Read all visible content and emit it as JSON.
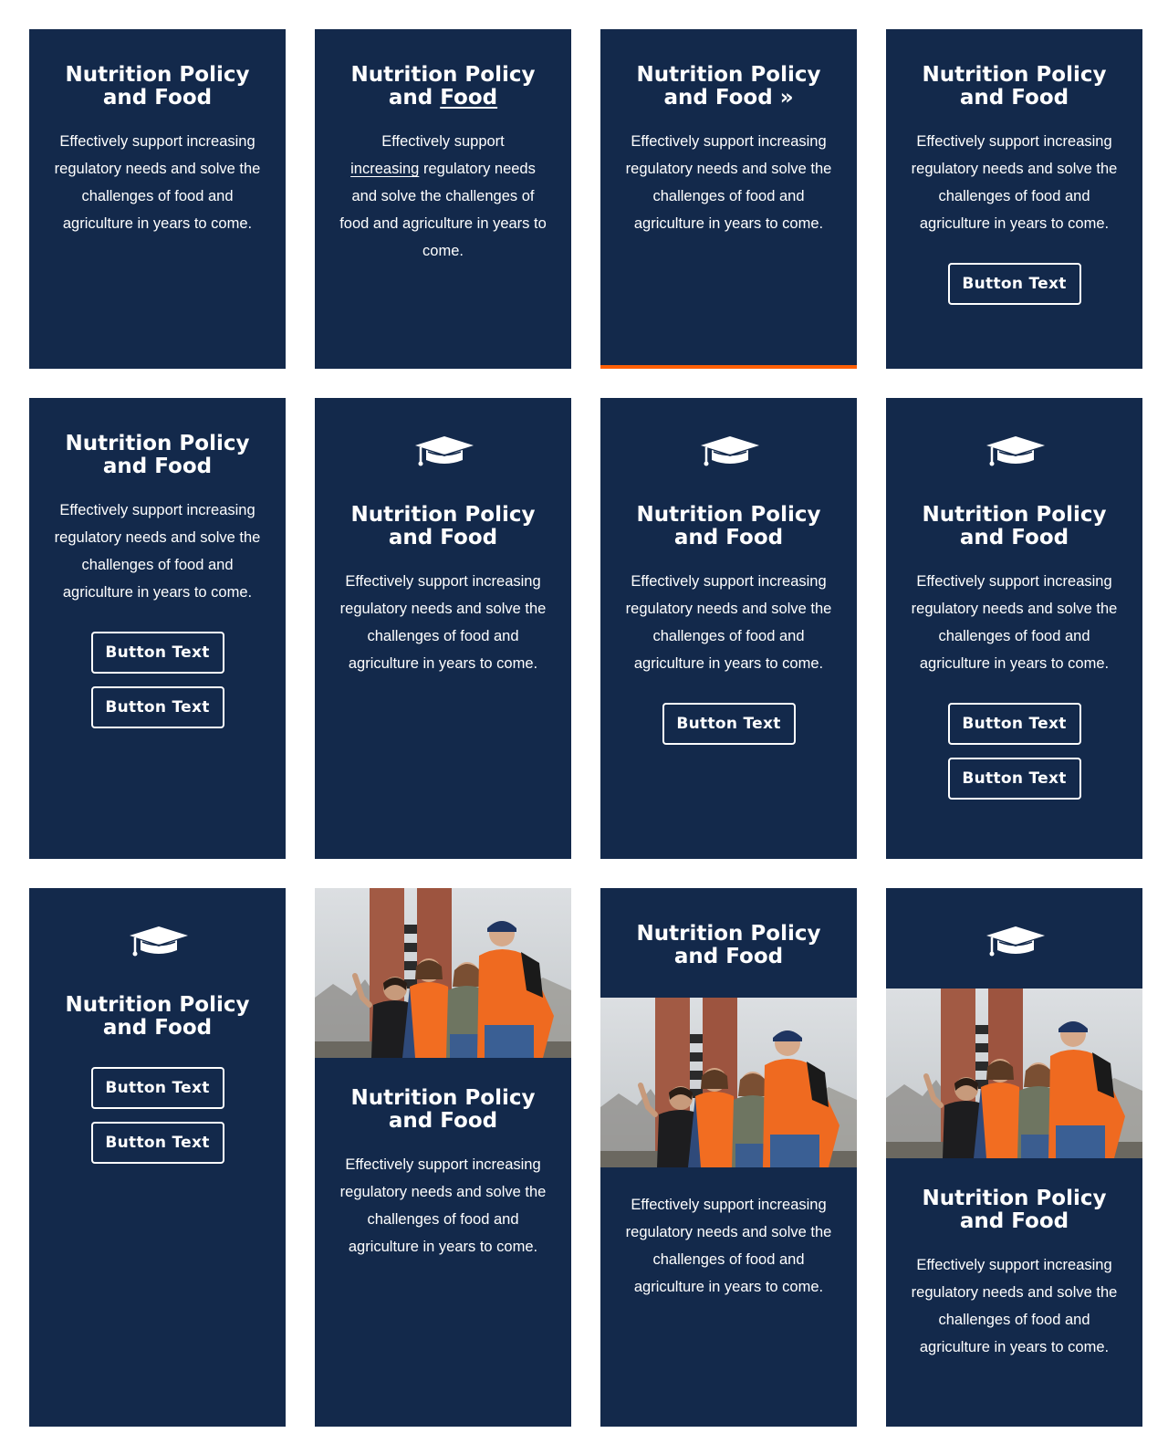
{
  "card_title_line1": "Nutrition Policy",
  "card_title_line2": "and Food",
  "card_title_line2_prefix": "and ",
  "card_title_line2_link": "Food",
  "card_desc": "Effectively support increasing regulatory needs and solve the challenges of food and agriculture in years to come.",
  "card_desc_prefix": "Effectively support ",
  "card_desc_link": "increasing",
  "card_desc_suffix": " regulatory needs and solve the challenges of food and agriculture in years to come.",
  "button_label": "Button Text",
  "chevron_glyph": "»",
  "colors": {
    "card_bg": "#13294b",
    "accent": "#ff5f05",
    "text": "#ffffff"
  },
  "icons": {
    "card_icon": "graduation-cap-icon",
    "photo": "students-photo"
  }
}
